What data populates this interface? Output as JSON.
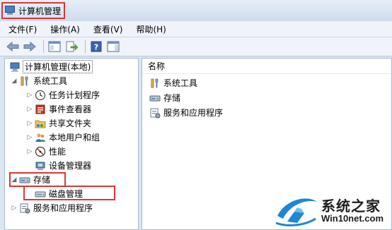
{
  "window": {
    "title": "计算机管理"
  },
  "menu": [
    "文件(F)",
    "操作(A)",
    "查看(V)",
    "帮助(H)"
  ],
  "toolbar": {
    "buttons": [
      "back-arrow-icon",
      "forward-arrow-icon",
      "show-console-tree-icon",
      "export-list-icon",
      "help-icon",
      "action-pane-icon"
    ]
  },
  "tree": {
    "root": "计算机管理(本地)",
    "system_tools": "系统工具",
    "task_scheduler": "任务计划程序",
    "event_viewer": "事件查看器",
    "shared_folders": "共享文件夹",
    "local_users": "本地用户和组",
    "performance": "性能",
    "device_manager": "设备管理器",
    "storage": "存储",
    "disk_management": "磁盘管理",
    "services_apps": "服务和应用程序"
  },
  "list": {
    "header_name": "名称",
    "items": [
      "系统工具",
      "存储",
      "服务和应用程序"
    ]
  },
  "watermark": {
    "brand": "系统之家",
    "url": "Win10net.com"
  }
}
